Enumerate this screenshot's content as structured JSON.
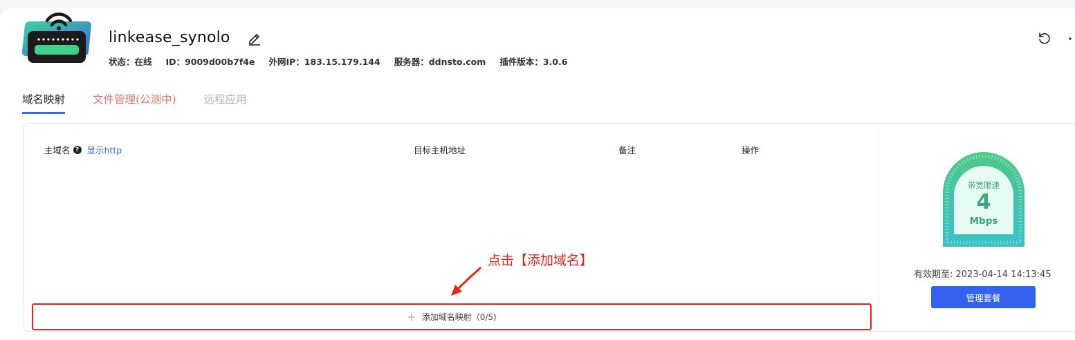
{
  "device": {
    "name": "linkease_synolo",
    "info": [
      {
        "label": "状态：",
        "value": "在线"
      },
      {
        "label": "ID：",
        "value": "9009d00b7f4e"
      },
      {
        "label": "外网IP：",
        "value": "183.15.179.144"
      },
      {
        "label": "服务器：",
        "value": "ddnsto.com"
      },
      {
        "label": "插件版本：",
        "value": "3.0.6"
      }
    ]
  },
  "tabs": [
    {
      "label": "域名映射",
      "state": "active"
    },
    {
      "label": "文件管理(公测中)",
      "state": "beta"
    },
    {
      "label": "远程应用",
      "state": "disabled"
    }
  ],
  "table": {
    "columns": {
      "domain": "主域名",
      "show_http": "显示http",
      "target": "目标主机地址",
      "note": "备注",
      "action": "操作"
    },
    "rows": []
  },
  "annotation": "点击【添加域名】",
  "add_button": "添加域名映射（0/5)",
  "plan": {
    "gauge_label": "带宽限速",
    "gauge_value": "4",
    "gauge_unit": "Mbps",
    "expiry": "有效期至: 2023-04-14 14:13:45",
    "manage_button": "管理套餐"
  },
  "colors": {
    "accent": "#3462f0",
    "annotation": "#e3251b",
    "gauge": "#3aa67a"
  }
}
